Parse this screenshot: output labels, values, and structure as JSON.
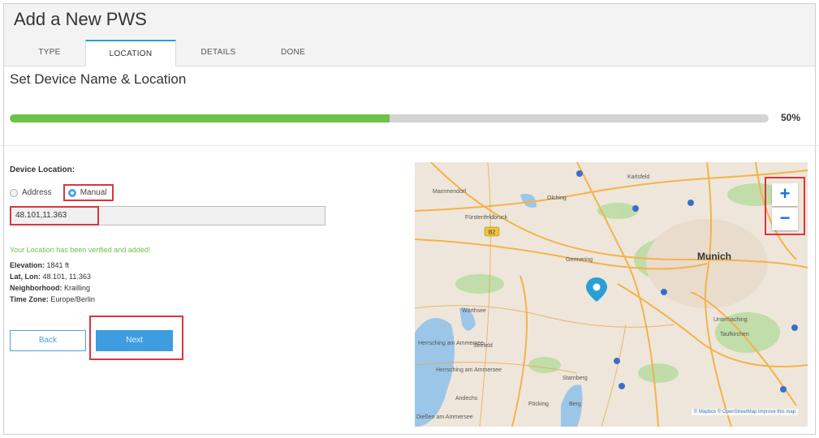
{
  "header": {
    "title": "Add a New PWS"
  },
  "tabs": [
    {
      "label": "TYPE"
    },
    {
      "label": "LOCATION"
    },
    {
      "label": "DETAILS"
    },
    {
      "label": "DONE"
    }
  ],
  "active_tab": "LOCATION",
  "section_title": "Set Device Name & Location",
  "progress": {
    "fraction": 0.5,
    "label": "50%"
  },
  "form": {
    "device_location_label": "Device Location:",
    "radio_address": "Address",
    "radio_manual": "Manual",
    "selected_mode": "Manual",
    "coordinates_value": "48.101,11.363",
    "verified_message": "Your Location has been verified and added!",
    "elevation_label": "Elevation:",
    "elevation_value": "1841 ft",
    "latlon_label": "Lat, Lon:",
    "latlon_value": "48.101, 11.363",
    "neighborhood_label": "Neighborhood:",
    "neighborhood_value": "Krailling",
    "timezone_label": "Time Zone:",
    "timezone_value": "Europe/Berlin",
    "back_label": "Back",
    "next_label": "Next"
  },
  "map": {
    "labels": {
      "karlsfeld": "Karlsfeld",
      "maisach": "Mammendorf",
      "olching": "Olching",
      "fuerstenfeldbruck": "Fürstenfeldbruck",
      "germering": "Germering",
      "munich": "Munich",
      "woerthsee": "Wörthsee",
      "herrsching": "Herrsching am Ammersee",
      "seefeld": "Seefeld",
      "herrsching2": "Herrsching am Ammersee",
      "unterhaching": "Unterhaching",
      "taufkirchen": "Taufkirchen",
      "starnberg": "Starnberg",
      "andechs": "Andechs",
      "pocking": "Pöcking",
      "berg": "Berg",
      "dienam": "Dießen am Ammersee",
      "road_b2": "B2"
    },
    "zoom_in": "+",
    "zoom_out": "−",
    "attribution": "© Mapbox © OpenStreetMap Improve this map",
    "colors": {
      "water": "#9cc6e8",
      "road": "#f2b34a",
      "park": "#b8dba0",
      "marker": "#2a9fd6"
    }
  }
}
